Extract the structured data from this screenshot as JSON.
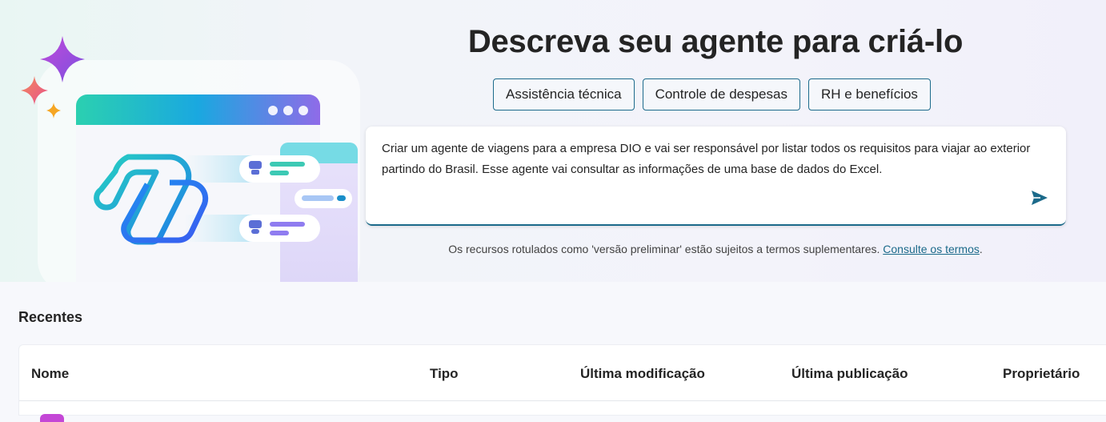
{
  "hero": {
    "headline": "Descreva seu agente para criá-lo",
    "chips": [
      "Assistência técnica",
      "Controle de despesas",
      "RH e benefícios"
    ],
    "prompt_text": "Criar um agente de viagens para a empresa DIO e vai ser responsável por listar todos os requisitos para viajar ao exterior partindo do Brasil. Esse agente vai consultar as informações de uma base de dados do Excel.",
    "send_icon": "send-icon",
    "terms_text": "Os recursos rotulados como 'versão preliminar' estão sujeitos a termos suplementares. ",
    "terms_link": "Consulte os termos",
    "terms_suffix": "."
  },
  "recentes": {
    "title": "Recentes",
    "columns": [
      "Nome",
      "Tipo",
      "Última modificação",
      "Última publicação",
      "Proprietário"
    ]
  },
  "colors": {
    "accent": "#1b6a8a",
    "heading": "#242424"
  }
}
